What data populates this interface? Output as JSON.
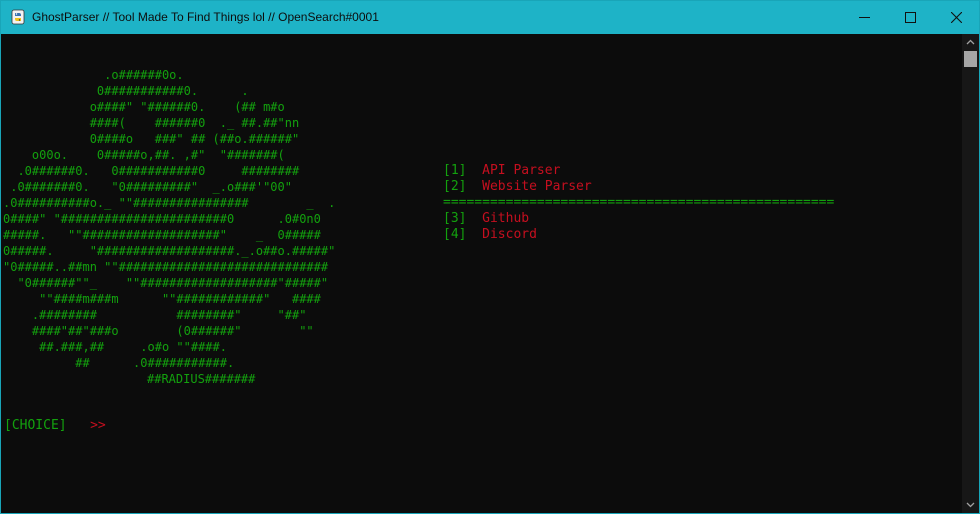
{
  "window": {
    "title": "GhostParser // Tool Made To Find Things lol // OpenSearch#0001"
  },
  "ascii_art": {
    "lines": [
      "              .o######0o.",
      "             0###########0.      .",
      "            o####\" \"######0.    (## m#o",
      "            ####(    ######0  ._ ##.##\"nn",
      "            0####o   ###\" ## (##o.######\"",
      "    o00o.    0#####o,##. ,#\"  \"#######(",
      "  .0######0.   0###########0     ########",
      " .0#######0.   \"0#########\"  _.o###'\"00\"",
      ".0##########o._ \"\"################        _  .",
      "0####\" \"#######################0      .0#0n0",
      "#####.   \"\"###################\"    _  0#####",
      "0#####.     \"###################._.o##o.#####\"",
      "\"0#####..##mn \"\"#############################",
      "  \"0######\"\"_    \"\"###################\"#####\"",
      "     \"\"####m###m      \"\"############\"   ####",
      "    .########           ########\"     \"##\"",
      "    ####\"##\"###o        (0######\"        \"\"",
      "     ##.###,##     .o#o \"\"####.",
      "          ##      .0###########."
    ],
    "signature": "##RADIUS#######"
  },
  "menu": {
    "items": [
      {
        "number": "[1]",
        "label": "API Parser"
      },
      {
        "number": "[2]",
        "label": "Website Parser"
      },
      {
        "number": "[3]",
        "label": "Github"
      },
      {
        "number": "[4]",
        "label": "Discord"
      }
    ],
    "separator": "=================================================="
  },
  "prompt": {
    "label": "[CHOICE]",
    "arrow": ">>"
  },
  "colors": {
    "titlebar": "#1eb3c7",
    "background": "#0c0c0c",
    "green": "#13a10e",
    "red": "#c50f1f"
  }
}
